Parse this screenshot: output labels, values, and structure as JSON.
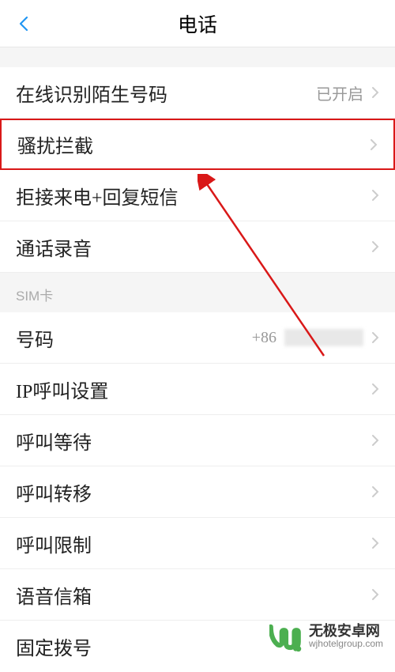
{
  "header": {
    "title": "电话"
  },
  "items": [
    {
      "label": "在线识别陌生号码",
      "value": "已开启"
    },
    {
      "label": "骚扰拦截",
      "value": ""
    },
    {
      "label": "拒接来电+回复短信",
      "value": ""
    },
    {
      "label": "通话录音",
      "value": ""
    }
  ],
  "section": {
    "label": "SIM卡"
  },
  "simItems": [
    {
      "label": "号码",
      "value": "+86"
    },
    {
      "label": "IP呼叫设置",
      "value": ""
    },
    {
      "label": "呼叫等待",
      "value": ""
    },
    {
      "label": "呼叫转移",
      "value": ""
    },
    {
      "label": "呼叫限制",
      "value": ""
    },
    {
      "label": "语音信箱",
      "value": ""
    },
    {
      "label": "固定拨号",
      "value": ""
    }
  ],
  "watermark": {
    "title": "无极安卓网",
    "url": "wjhotelgroup.com"
  }
}
